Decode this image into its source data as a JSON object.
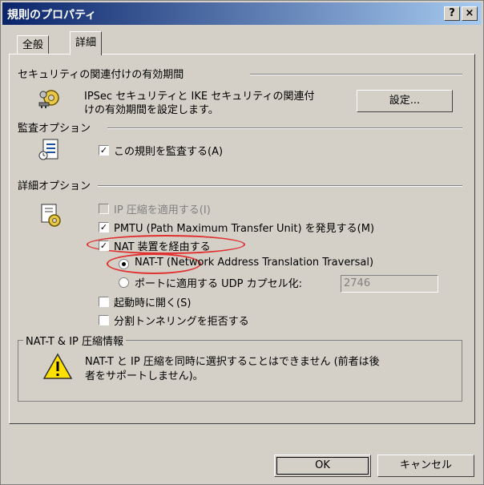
{
  "window": {
    "title": "規則のプロパティ",
    "help_label": "?",
    "close_label": "×"
  },
  "tabs": [
    {
      "label": "全般"
    },
    {
      "label": "詳細"
    }
  ],
  "security_section": {
    "header": "セキュリティの関連付けの有効期間",
    "description_line1": "IPSec セキュリティと IKE セキュリティの関連付",
    "description_line2": "けの有効期間を設定します。",
    "settings_button": "設定..."
  },
  "audit_section": {
    "header": "監査オプション",
    "checkbox_label": "この規則を監査する(A)",
    "checked": true
  },
  "advanced_section": {
    "header": "詳細オプション",
    "options": {
      "ip_compression": {
        "label": "IP 圧縮を適用する(I)",
        "checked": false,
        "enabled": false
      },
      "pmtu": {
        "label": "PMTU (Path Maximum Transfer Unit) を発見する(M)",
        "checked": true
      },
      "nat_traversal": {
        "label": "NAT 装置を経由する",
        "checked": true
      },
      "nat_t_radio": {
        "label": "NAT-T (Network Address Translation Traversal)",
        "selected": true
      },
      "udp_radio": {
        "label": "ポートに適用する UDP カプセル化:",
        "selected": false
      },
      "udp_port_value": "2746",
      "connect_on_start": {
        "label": "起動時に開く(S)",
        "checked": false
      },
      "reject_split_tunnel": {
        "label": "分割トンネリングを拒否する",
        "checked": false
      }
    }
  },
  "info_group": {
    "title": "NAT-T & IP 圧縮情報",
    "line1": "NAT-T と IP 圧縮を同時に選択することはできません (前者は後",
    "line2": "者をサポートしません)。"
  },
  "footer": {
    "ok_label": "OK",
    "cancel_label": "キャンセル"
  },
  "colors": {
    "titlebar_start": "#0a246a",
    "titlebar_end": "#a6caf0",
    "dialog_bg": "#d4d0c8",
    "highlight_ellipse": "#e03030"
  }
}
